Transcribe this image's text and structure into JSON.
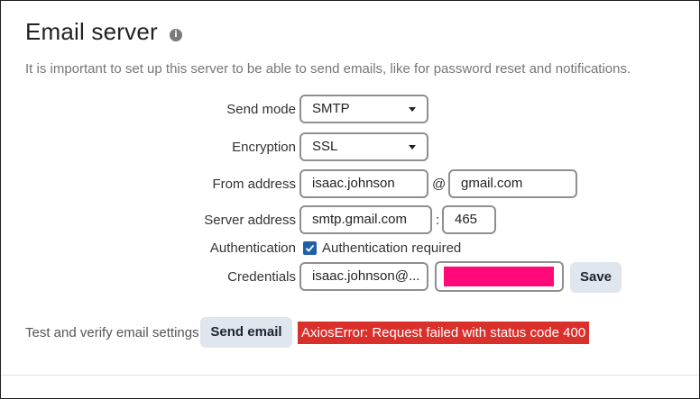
{
  "section": {
    "title": "Email server",
    "info_icon": "info-icon",
    "description": "It is important to set up this server to be able to send emails, like for password reset and notifications."
  },
  "form": {
    "send_mode": {
      "label": "Send mode",
      "value": "SMTP"
    },
    "encryption": {
      "label": "Encryption",
      "value": "SSL"
    },
    "from_address": {
      "label": "From address",
      "user": "isaac.johnson",
      "at": "@",
      "domain": "gmail.com"
    },
    "server_address": {
      "label": "Server address",
      "host": "smtp.gmail.com",
      "colon": ":",
      "port": "465"
    },
    "authentication": {
      "label": "Authentication",
      "checkbox_label": "Authentication required",
      "checked": true
    },
    "credentials": {
      "label": "Credentials",
      "username": "isaac.johnson@...",
      "save_label": "Save",
      "password_mask_color": "#ff0a78"
    }
  },
  "test": {
    "label": "Test and verify email settings",
    "button_label": "Send email",
    "error": "AxiosError: Request failed with status code 400"
  },
  "colors": {
    "error_bg": "#d9302c",
    "checkbox": "#1f5fa8",
    "button_bg": "#dfe6ee"
  }
}
